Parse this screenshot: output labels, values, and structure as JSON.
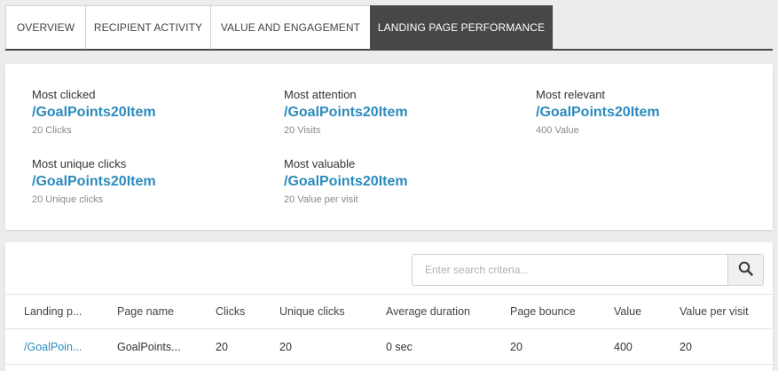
{
  "tabs": [
    {
      "label": "OVERVIEW",
      "active": false
    },
    {
      "label": "RECIPIENT ACTIVITY",
      "active": false
    },
    {
      "label": "VALUE AND ENGAGEMENT",
      "active": false
    },
    {
      "label": "LANDING PAGE PERFORMANCE",
      "active": true
    }
  ],
  "highlights": {
    "most_clicked": {
      "label": "Most clicked",
      "link": "/GoalPoints20Item",
      "sub": "20 Clicks"
    },
    "most_attention": {
      "label": "Most attention",
      "link": "/GoalPoints20Item",
      "sub": "20 Visits"
    },
    "most_relevant": {
      "label": "Most relevant",
      "link": "/GoalPoints20Item",
      "sub": "400 Value"
    },
    "most_unique_clicks": {
      "label": "Most unique clicks",
      "link": "/GoalPoints20Item",
      "sub": "20 Unique clicks"
    },
    "most_valuable": {
      "label": "Most valuable",
      "link": "/GoalPoints20Item",
      "sub": "20 Value per visit"
    }
  },
  "search": {
    "placeholder": "Enter search criteria...",
    "value": "",
    "icon": "search-icon"
  },
  "table": {
    "columns": [
      "Landing p...",
      "Page name",
      "Clicks",
      "Unique clicks",
      "Average duration",
      "Page bounce",
      "Value",
      "Value per visit"
    ],
    "rows": [
      [
        "/GoalPoin...",
        "GoalPoints...",
        "20",
        "20",
        "0 sec",
        "20",
        "400",
        "20"
      ]
    ]
  },
  "colors": {
    "accent": "#2b8bbd",
    "active_tab": "#474747",
    "background": "#ececec"
  }
}
